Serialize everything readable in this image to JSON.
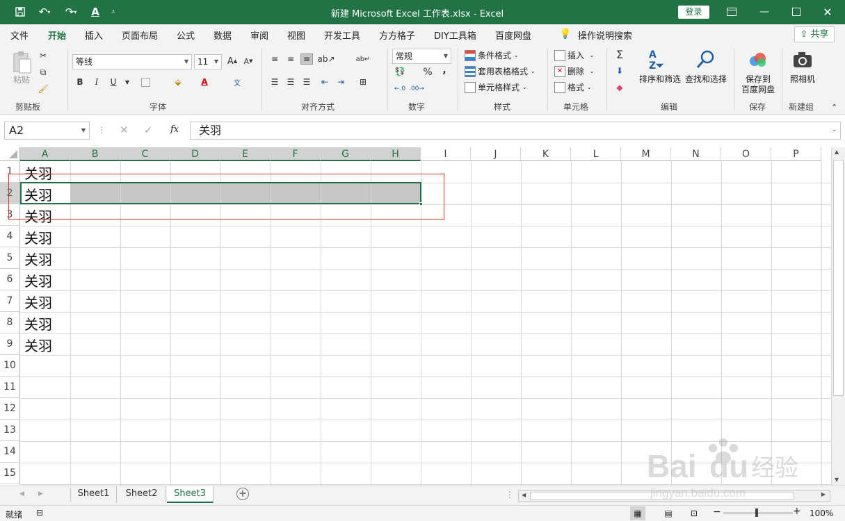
{
  "titlebar": {
    "title": "新建 Microsoft Excel 工作表.xlsx  -  Excel",
    "login": "登录",
    "accent": "#217346"
  },
  "tabs": [
    "文件",
    "开始",
    "插入",
    "页面布局",
    "公式",
    "数据",
    "审阅",
    "视图",
    "开发工具",
    "方方格子",
    "DIY工具箱",
    "百度网盘"
  ],
  "tell_me": "操作说明搜索",
  "share": "共享",
  "ribbon": {
    "clipboard": {
      "paste": "粘贴",
      "label": "剪贴板"
    },
    "font": {
      "name": "等线",
      "size": "11",
      "label": "字体",
      "bold": "B",
      "italic": "I",
      "underline": "U"
    },
    "alignment": {
      "label": "对齐方式"
    },
    "number": {
      "format": "常规",
      "label": "数字",
      "percent": "%",
      "comma": ","
    },
    "styles": {
      "conditional": "条件格式",
      "table": "套用表格格式",
      "cell": "单元格样式",
      "label": "样式"
    },
    "cells": {
      "insert": "插入",
      "delete": "删除",
      "format": "格式",
      "label": "单元格"
    },
    "editing": {
      "sort": "排序和筛选",
      "find": "查找和选择",
      "label": "编辑"
    },
    "save": {
      "btn1": "保存到",
      "btn2": "百度网盘",
      "label": "保存"
    },
    "camera": {
      "btn": "照相机",
      "label": "新建组"
    }
  },
  "formula_bar": {
    "name_box": "A2",
    "content": "关羽",
    "fx": "fx"
  },
  "grid": {
    "columns": [
      "A",
      "B",
      "C",
      "D",
      "E",
      "F",
      "G",
      "H",
      "I",
      "J",
      "K",
      "L",
      "M",
      "N",
      "O",
      "P"
    ],
    "selected_columns": [
      "A",
      "B",
      "C",
      "D",
      "E",
      "F",
      "G",
      "H"
    ],
    "rows": [
      "1",
      "2",
      "3",
      "4",
      "5",
      "6",
      "7",
      "8",
      "9",
      "10",
      "11",
      "12",
      "13",
      "14",
      "15"
    ],
    "column_a_values": [
      "关羽",
      "关羽",
      "关羽",
      "关羽",
      "关羽",
      "关羽",
      "关羽",
      "关羽",
      "关羽"
    ],
    "active_cell": "A2",
    "selected_range": "A2:H2"
  },
  "sheets": [
    "Sheet1",
    "Sheet2",
    "Sheet3"
  ],
  "active_sheet": "Sheet3",
  "statusbar": {
    "ready": "就绪",
    "zoom": "100%"
  },
  "watermark": {
    "line1": "Baidu 经验",
    "line2": "jingyan.baidu.com"
  }
}
